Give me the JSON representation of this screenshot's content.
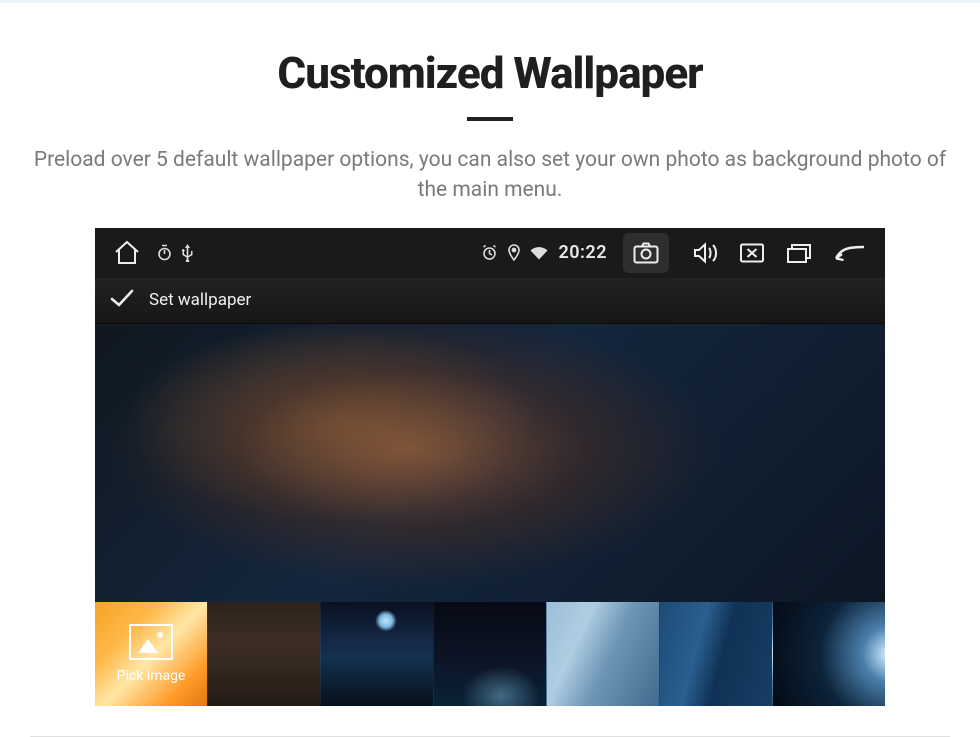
{
  "page": {
    "title": "Customized Wallpaper",
    "subtitle": "Preload over 5 default wallpaper options, you can also set your own photo as background photo of the main menu."
  },
  "statusbar": {
    "time": "20:22"
  },
  "appbar": {
    "title": "Set wallpaper"
  },
  "thumbs": {
    "pick_label": "Pick image"
  }
}
